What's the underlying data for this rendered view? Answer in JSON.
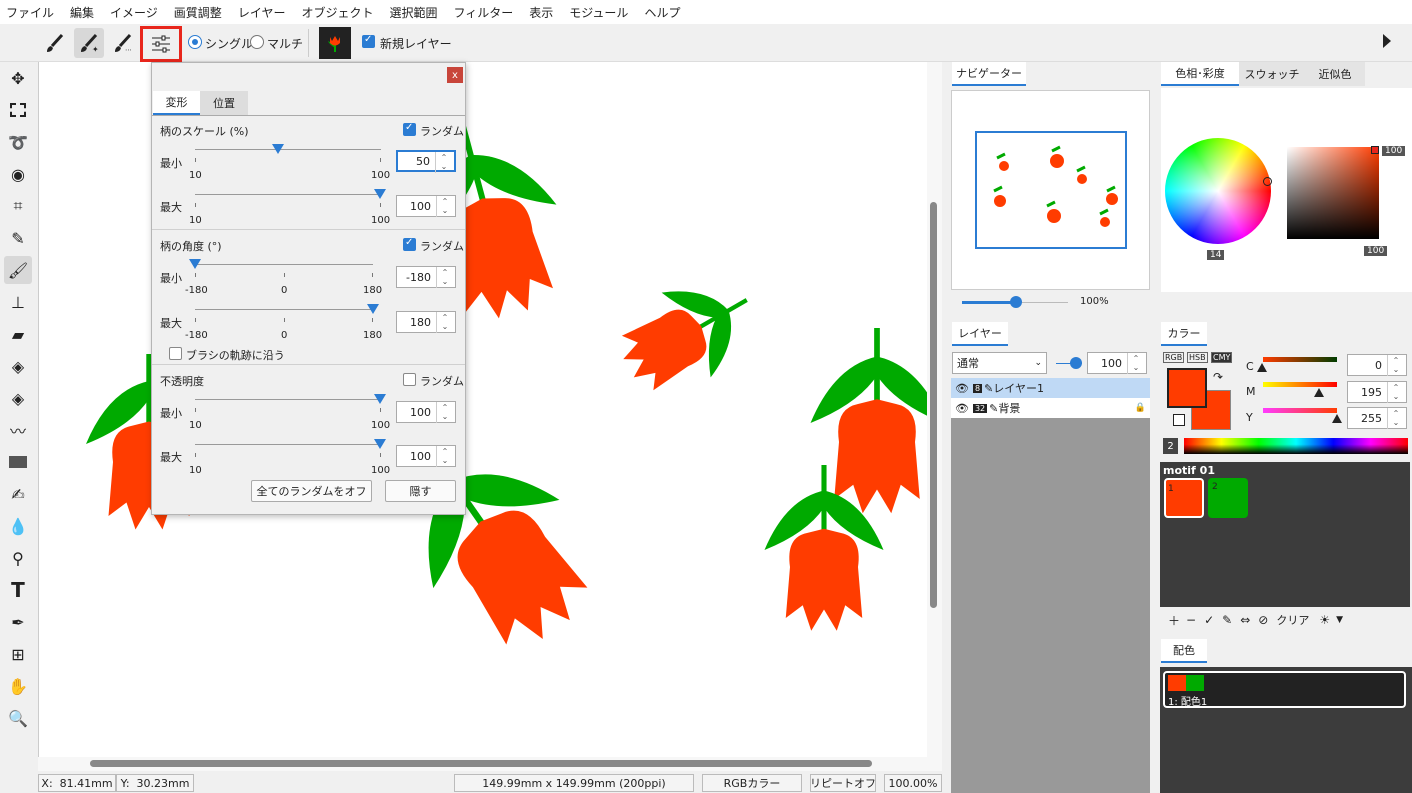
{
  "menu": [
    "ファイル",
    "編集",
    "イメージ",
    "画質調整",
    "レイヤー",
    "オブジェクト",
    "選択範囲",
    "フィルター",
    "表示",
    "モジュール",
    "ヘルプ"
  ],
  "toolbar": {
    "single_label": "シングル",
    "multi_label": "マルチ",
    "new_layer_label": "新規レイヤー",
    "new_layer_checked": true
  },
  "dialog": {
    "close": "x",
    "tabs": [
      "変形",
      "位置"
    ],
    "scale": {
      "title": "柄のスケール (%)",
      "random_label": "ランダム",
      "random": true,
      "min": {
        "label": "最小",
        "value": "50",
        "lo": "10",
        "hi": "100"
      },
      "max": {
        "label": "最大",
        "value": "100",
        "lo": "10",
        "hi": "100"
      }
    },
    "angle": {
      "title": "柄の角度 (°)",
      "random_label": "ランダム",
      "random": true,
      "min": {
        "label": "最小",
        "value": "-180",
        "lo": "-180",
        "mid": "0",
        "hi": "180"
      },
      "max": {
        "label": "最大",
        "value": "180",
        "lo": "-180",
        "mid": "0",
        "hi": "180"
      },
      "follow": "ブラシの軌跡に沿う"
    },
    "opacity": {
      "title": "不透明度",
      "random_label": "ランダム",
      "random": false,
      "min": {
        "label": "最小",
        "value": "100",
        "lo": "10",
        "hi": "100"
      },
      "max": {
        "label": "最大",
        "value": "100",
        "lo": "10",
        "hi": "100"
      }
    },
    "all_off": "全てのランダムをオフ",
    "hide": "隠す"
  },
  "navigator": {
    "tab": "ナビゲーター",
    "zoom": "100%"
  },
  "layers": {
    "tab": "レイヤー",
    "blend": "通常",
    "opacity": "100",
    "items": [
      {
        "bits": "8",
        "name": "レイヤー1",
        "selected": true
      },
      {
        "bits": "32",
        "name": "背景",
        "locked": true
      }
    ]
  },
  "color_panel": {
    "tabs": [
      "色相･彩度",
      "スウォッチ",
      "近似色"
    ],
    "hue": "14",
    "sat": "100",
    "val": "100"
  },
  "kara": {
    "tab": "カラー",
    "modes": [
      "RGB",
      "HSB",
      "CMY"
    ],
    "c_label": "C",
    "m_label": "M",
    "y_label": "Y",
    "c": "0",
    "m": "195",
    "y": "255",
    "index": "2",
    "fg": "#ff3c00",
    "bg": "#ff3c00"
  },
  "motif": {
    "title": "motif 01",
    "items": [
      {
        "num": "1",
        "color": "#ff3c00"
      },
      {
        "num": "2",
        "color": "#00aa00"
      }
    ],
    "clear": "クリア"
  },
  "haisyoku": {
    "tab": "配色",
    "item": "1: 配色1"
  },
  "status": {
    "x_label": "X:",
    "x": "81.41mm",
    "y_label": "Y:",
    "y": "30.23mm",
    "size": "149.99mm x 149.99mm (200ppi)",
    "mode": "RGBカラー",
    "repeat": "リピートオフ",
    "zoom": "100.00%"
  },
  "colors": {
    "flower": "#ff3c00",
    "leaf": "#00aa00",
    "accent": "#2b7cd3"
  }
}
